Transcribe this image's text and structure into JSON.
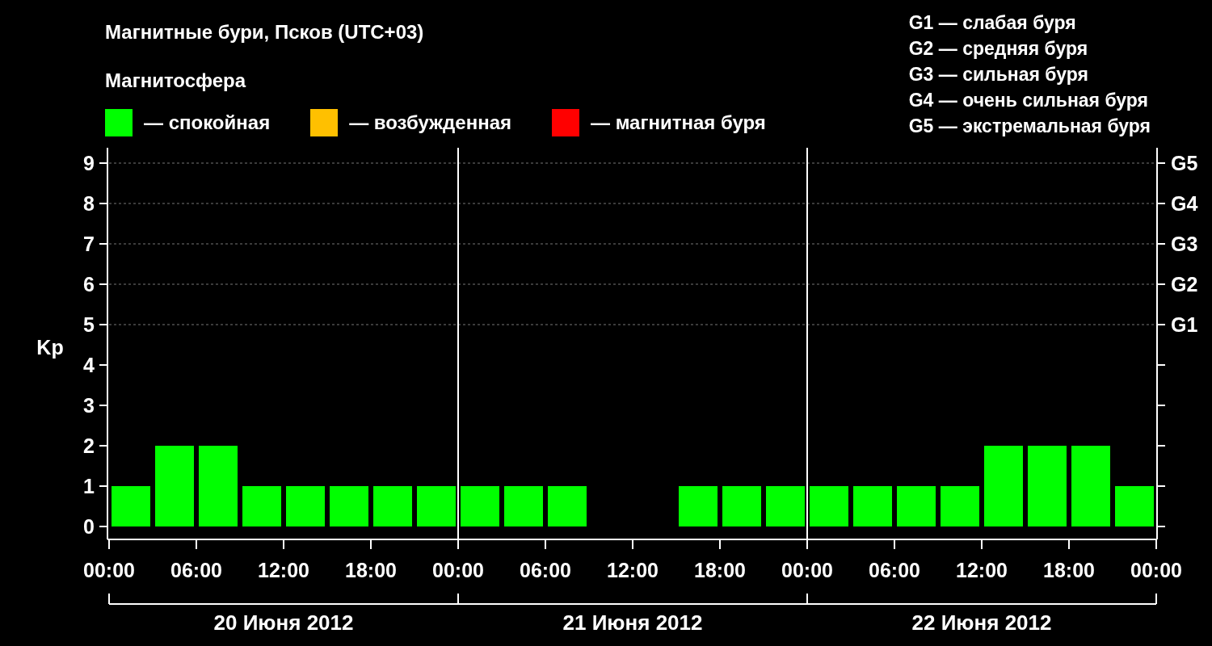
{
  "title": "Магнитные бури, Псков (UTC+03)",
  "legend_title": "Магнитосфера",
  "legend": [
    {
      "label": "— спокойная",
      "color": "#00ff00"
    },
    {
      "label": "— возбужденная",
      "color": "#ffc000"
    },
    {
      "label": "— магнитная буря",
      "color": "#ff0000"
    }
  ],
  "storm_levels": [
    "G1 — слабая буря",
    "G2 — средняя буря",
    "G3 — сильная буря",
    "G4 — очень сильная буря",
    "G5 — экстремальная буря"
  ],
  "chart": {
    "chart_data": {
      "type": "bar",
      "ylabel": "Kp",
      "x": [
        "2012-06-20T01:30",
        "2012-06-20T04:30",
        "2012-06-20T07:30",
        "2012-06-20T10:30",
        "2012-06-20T13:30",
        "2012-06-20T16:30",
        "2012-06-20T19:30",
        "2012-06-20T22:30",
        "2012-06-21T01:30",
        "2012-06-21T04:30",
        "2012-06-21T07:30",
        "2012-06-21T10:30",
        "2012-06-21T13:30",
        "2012-06-21T16:30",
        "2012-06-21T19:30",
        "2012-06-21T22:30",
        "2012-06-22T01:30",
        "2012-06-22T04:30",
        "2012-06-22T07:30",
        "2012-06-22T10:30",
        "2012-06-22T13:30",
        "2012-06-22T16:30",
        "2012-06-22T19:30",
        "2012-06-22T22:30"
      ],
      "series": [
        {
          "color": "#00ff00",
          "values": [
            1,
            2,
            2,
            1,
            1,
            1,
            1,
            1,
            1,
            1,
            1,
            null,
            null,
            1,
            1,
            1,
            1,
            1,
            1,
            1,
            2,
            2,
            2,
            1
          ]
        }
      ],
      "xlim": [
        "2012-06-20T00:00",
        "2012-06-23T00:00"
      ],
      "ylim": [
        -0.32,
        9.38
      ],
      "xticks": [
        {
          "value": "2012-06-20T00:00",
          "label": "00:00"
        },
        {
          "value": "2012-06-20T06:00",
          "label": "06:00"
        },
        {
          "value": "2012-06-20T12:00",
          "label": "12:00"
        },
        {
          "value": "2012-06-20T18:00",
          "label": "18:00"
        },
        {
          "value": "2012-06-21T00:00",
          "label": "00:00"
        },
        {
          "value": "2012-06-21T06:00",
          "label": "06:00"
        },
        {
          "value": "2012-06-21T12:00",
          "label": "12:00"
        },
        {
          "value": "2012-06-21T18:00",
          "label": "18:00"
        },
        {
          "value": "2012-06-22T00:00",
          "label": "00:00"
        },
        {
          "value": "2012-06-22T06:00",
          "label": "06:00"
        },
        {
          "value": "2012-06-22T12:00",
          "label": "12:00"
        },
        {
          "value": "2012-06-22T18:00",
          "label": "18:00"
        },
        {
          "value": "2012-06-23T00:00",
          "label": "00:00"
        }
      ],
      "yticks": [
        0,
        1,
        2,
        3,
        4,
        5,
        6,
        7,
        8,
        9
      ],
      "grid": true
    },
    "storm_axis_labels": [
      "G5",
      "G4",
      "G3",
      "G2",
      "G1"
    ],
    "days": [
      "20 Июня 2012",
      "21 Июня 2012",
      "22 Июня 2012"
    ]
  }
}
